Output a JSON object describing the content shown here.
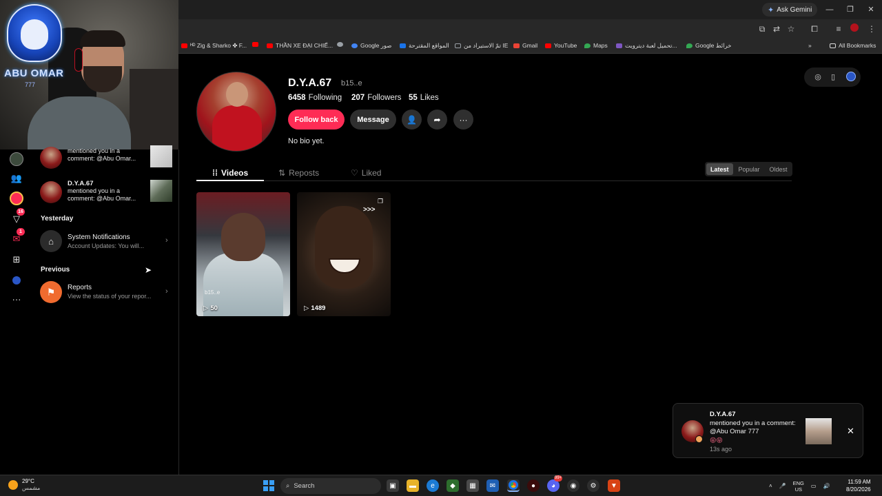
{
  "browser": {
    "ask_gemini": "Ask Gemini",
    "bookmarks": [
      {
        "label": "ᴴᴰ Zig & Sharko ✤ F...",
        "color": "#ff0000"
      },
      {
        "label": "",
        "color": "#ff0000"
      },
      {
        "label": "THẦN XE ĐẠI CHIẾ...",
        "color": "#ff0000"
      },
      {
        "label": "",
        "color": "#9aa0a6"
      },
      {
        "label": "Google صور",
        "color": "#4285f4"
      },
      {
        "label": "المواقع المقترحة",
        "color": "#1a73e8"
      },
      {
        "label": "تمّ الاستيراد من IE",
        "color": "#9aa0a6"
      },
      {
        "label": "Gmail",
        "color": "#ea4335"
      },
      {
        "label": "YouTube",
        "color": "#ff0000"
      },
      {
        "label": "Maps",
        "color": "#34a853"
      },
      {
        "label": "تحميل لعبة ديترويت...",
        "color": "#7e57c2"
      },
      {
        "label": "Google خرائط",
        "color": "#34a853"
      }
    ],
    "all_bookmarks": "All Bookmarks"
  },
  "webcam": {
    "brand": "ABU OMAR",
    "number": "777"
  },
  "rail": {
    "badge_explore": "16",
    "badge_messages": "1"
  },
  "notifications": {
    "item0": {
      "body": "mentioned you in a comment: @Abu Omar..."
    },
    "item1": {
      "title": "D.Y.A.67",
      "body": "mentioned you in a comment: @Abu Omar..."
    },
    "section_yesterday": "Yesterday",
    "system": {
      "title": "System Notifications",
      "sub": "Account Updates: You will..."
    },
    "section_previous": "Previous",
    "reports": {
      "title": "Reports",
      "sub": "View the status of your repor..."
    }
  },
  "profile": {
    "username": "D.Y.A.67",
    "handle": "b15..e",
    "following_count": "6458",
    "following_label": "Following",
    "followers_count": "207",
    "followers_label": "Followers",
    "likes_count": "55",
    "likes_label": "Likes",
    "follow_back": "Follow back",
    "message": "Message",
    "bio": "No bio yet.",
    "tabs": {
      "videos": "Videos",
      "reposts": "Reposts",
      "liked": "Liked"
    },
    "sort": {
      "latest": "Latest",
      "popular": "Popular",
      "oldest": "Oldest"
    },
    "videos": [
      {
        "views": "50",
        "tag": "b15..e"
      },
      {
        "views": "1489",
        "arrows": ">>>"
      }
    ]
  },
  "toast": {
    "title": "D.Y.A.67",
    "body": "mentioned you in a comment: @Abu Omar 777",
    "emoji": "😝😝",
    "time": "13s ago"
  },
  "taskbar": {
    "temperature": "29°C",
    "weather_desc": "مشمس",
    "search": "Search",
    "lang_top": "ENG",
    "lang_bottom": "US",
    "time": "11:59 AM",
    "date": "8/20/2026",
    "notif_badge": "99+"
  }
}
